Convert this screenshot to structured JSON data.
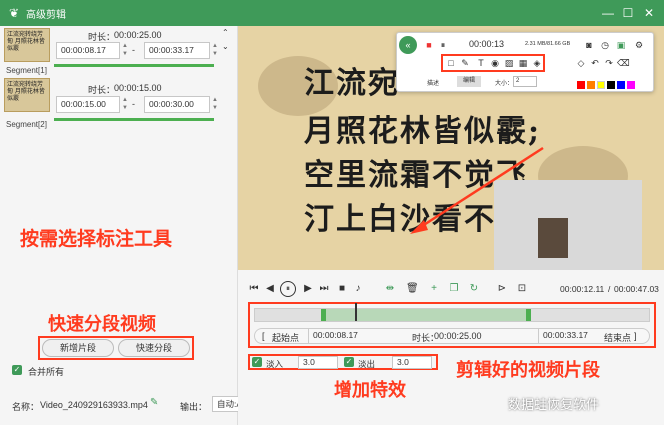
{
  "window": {
    "title": "高级剪辑",
    "minimize": "—",
    "maximize": "☐",
    "close": "✕"
  },
  "segments": [
    {
      "label": "Segment[1]",
      "thumb_text": "江流宛转绕芳甸 月照花林皆似霰",
      "duration_label": "时长：",
      "duration": "00:00:25.00",
      "start": "00:00:08.17",
      "end": "00:00:33.17",
      "dash": "-"
    },
    {
      "label": "Segment[2]",
      "thumb_text": "江流宛转绕芳甸 月照花林皆似霰",
      "duration_label": "时长：",
      "duration": "00:00:15.00",
      "start": "00:00:15.00",
      "end": "00:00:30.00",
      "dash": "-"
    }
  ],
  "annotations": {
    "select_tool": "按需选择标注工具",
    "quick_split": "快速分段视频",
    "add_effects": "增加特效",
    "clip_segment": "剪辑好的视频片段"
  },
  "left_buttons": {
    "add_segment": "新增片段",
    "quick_split": "快速分段"
  },
  "merge_all": {
    "label": "合并所有",
    "checked": true
  },
  "filename": {
    "label": "名称：",
    "value": "Video_240929163933.mp4"
  },
  "output": {
    "label": "输出：",
    "value": "自动:Auto"
  },
  "video": {
    "poem_lines": [
      "江流宛",
      "月照花林皆似霰;",
      "空里流霜不觉飞,",
      "汀上白沙看不"
    ]
  },
  "toolbar": {
    "time": "00:00:13",
    "size": "2.31 MB/81.66 GB",
    "tab_line": "描述",
    "tab_active": "编辑",
    "size_label": "大小：",
    "size_value": "2",
    "swatch_colors": [
      "#ff0000",
      "#ff7f00",
      "#ffff00",
      "#000000",
      "#0000ff",
      "#ff00ff"
    ]
  },
  "player": {
    "current_time": "00:00:12.11",
    "total_time": "00:00:47.03",
    "time_sep": "/"
  },
  "clip": {
    "start_label": "起始点",
    "start": "00:00:08.17",
    "duration_label": "时长：",
    "duration": "00:00:25.00",
    "end": "00:00:33.17",
    "end_label": "结束点"
  },
  "effects": {
    "fade_in_label": "淡入",
    "fade_in": "3.0",
    "fade_out_label": "淡出",
    "fade_out": "3.0"
  },
  "watermark": "数据蛙恢复软件",
  "colors": {
    "accent": "#3f9a59",
    "annotation": "#ff3b1f"
  }
}
